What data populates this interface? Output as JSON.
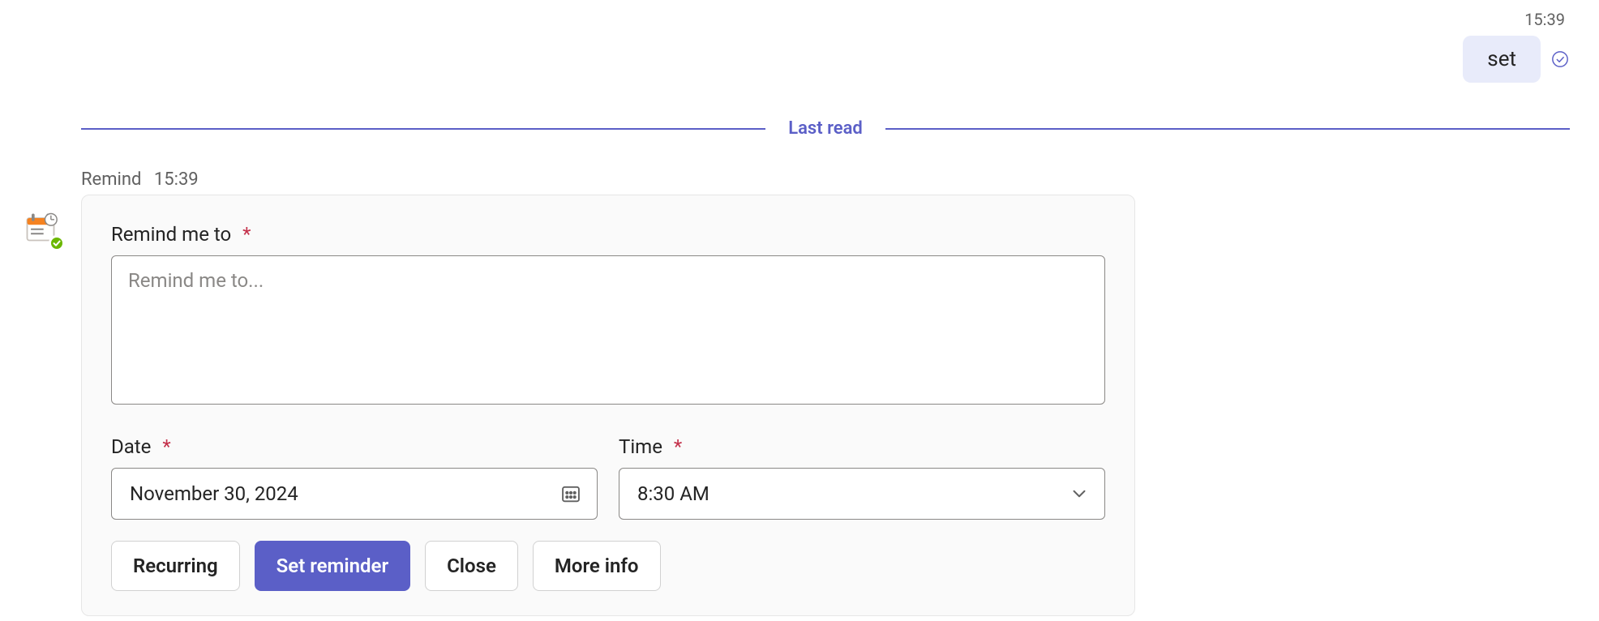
{
  "outgoing": {
    "time": "15:39",
    "text": "set"
  },
  "divider": {
    "label": "Last read"
  },
  "bot": {
    "name": "Remind",
    "time": "15:39"
  },
  "form": {
    "remind_label": "Remind me to",
    "remind_placeholder": "Remind me to...",
    "remind_value": "",
    "date_label": "Date",
    "date_value": "November 30, 2024",
    "time_label": "Time",
    "time_value": "8:30 AM",
    "required_mark": "*"
  },
  "buttons": {
    "recurring": "Recurring",
    "set_reminder": "Set reminder",
    "close": "Close",
    "more_info": "More info"
  }
}
